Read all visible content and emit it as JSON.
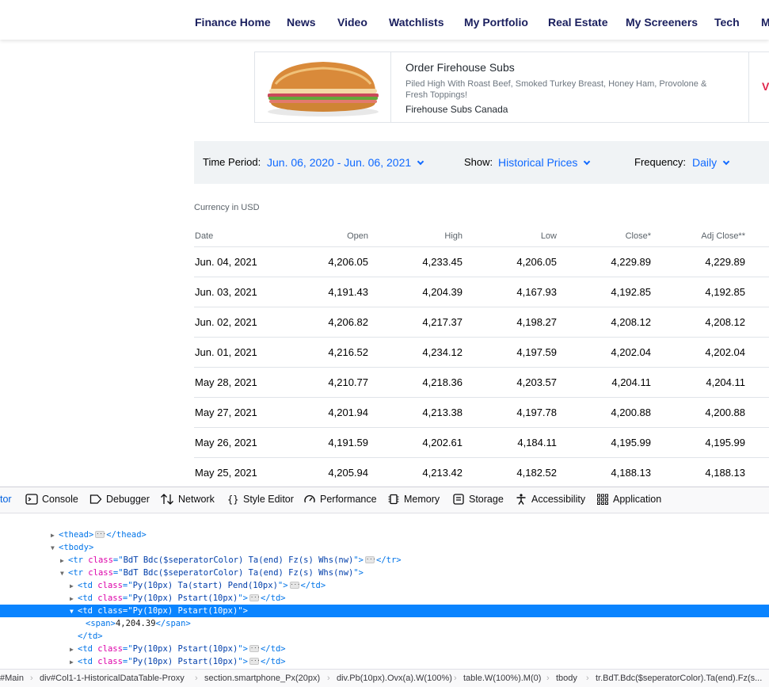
{
  "nav": [
    "Finance Home",
    "News",
    "Video",
    "Watchlists",
    "My Portfolio",
    "Real Estate",
    "My Screeners",
    "Tech",
    "M"
  ],
  "ad": {
    "title": "Order Firehouse Subs",
    "description": "Piled High With Roast Beef, Smoked Turkey Breast, Honey Ham, Provolone & Fresh Toppings!",
    "source": "Firehouse Subs Canada",
    "right_mark": "V"
  },
  "controls": {
    "time_period_label": "Time Period:",
    "time_period_value": "Jun. 06, 2020 - Jun. 06, 2021",
    "show_label": "Show:",
    "show_value": "Historical Prices",
    "frequency_label": "Frequency:",
    "frequency_value": "Daily"
  },
  "currency": "Currency in USD",
  "table": {
    "headers": [
      "Date",
      "Open",
      "High",
      "Low",
      "Close*",
      "Adj Close**"
    ],
    "rows": [
      [
        "Jun. 04, 2021",
        "4,206.05",
        "4,233.45",
        "4,206.05",
        "4,229.89",
        "4,229.89"
      ],
      [
        "Jun. 03, 2021",
        "4,191.43",
        "4,204.39",
        "4,167.93",
        "4,192.85",
        "4,192.85"
      ],
      [
        "Jun. 02, 2021",
        "4,206.82",
        "4,217.37",
        "4,198.27",
        "4,208.12",
        "4,208.12"
      ],
      [
        "Jun. 01, 2021",
        "4,216.52",
        "4,234.12",
        "4,197.59",
        "4,202.04",
        "4,202.04"
      ],
      [
        "May 28, 2021",
        "4,210.77",
        "4,218.36",
        "4,203.57",
        "4,204.11",
        "4,204.11"
      ],
      [
        "May 27, 2021",
        "4,201.94",
        "4,213.38",
        "4,197.78",
        "4,200.88",
        "4,200.88"
      ],
      [
        "May 26, 2021",
        "4,191.59",
        "4,202.61",
        "4,184.11",
        "4,195.99",
        "4,195.99"
      ],
      [
        "May 25, 2021",
        "4,205.94",
        "4,213.42",
        "4,182.52",
        "4,188.13",
        "4,188.13"
      ]
    ]
  },
  "devtools": {
    "tabs": [
      "tor",
      "Console",
      "Debugger",
      "Network",
      "Style Editor",
      "Performance",
      "Memory",
      "Storage",
      "Accessibility",
      "Application"
    ],
    "tree": {
      "thead": "thead",
      "tbody": "tbody",
      "tr_class": "BdT Bdc($seperatorColor) Ta(end) Fz(s) Whs(nw)",
      "td1_class": "Py(10px) Ta(start) Pend(10px)",
      "td_class": "Py(10px) Pstart(10px)",
      "span_text": "4,204.39"
    },
    "breadcrumb": [
      "#Main",
      "div#Col1-1-HistoricalDataTable-Proxy",
      "section.smartphone_Px(20px)",
      "div.Pb(10px).Ovx(a).W(100%)",
      "table.W(100%).M(0)",
      "tbody",
      "tr.BdT.Bdc($seperatorColor).Ta(end).Fz(s..."
    ]
  }
}
